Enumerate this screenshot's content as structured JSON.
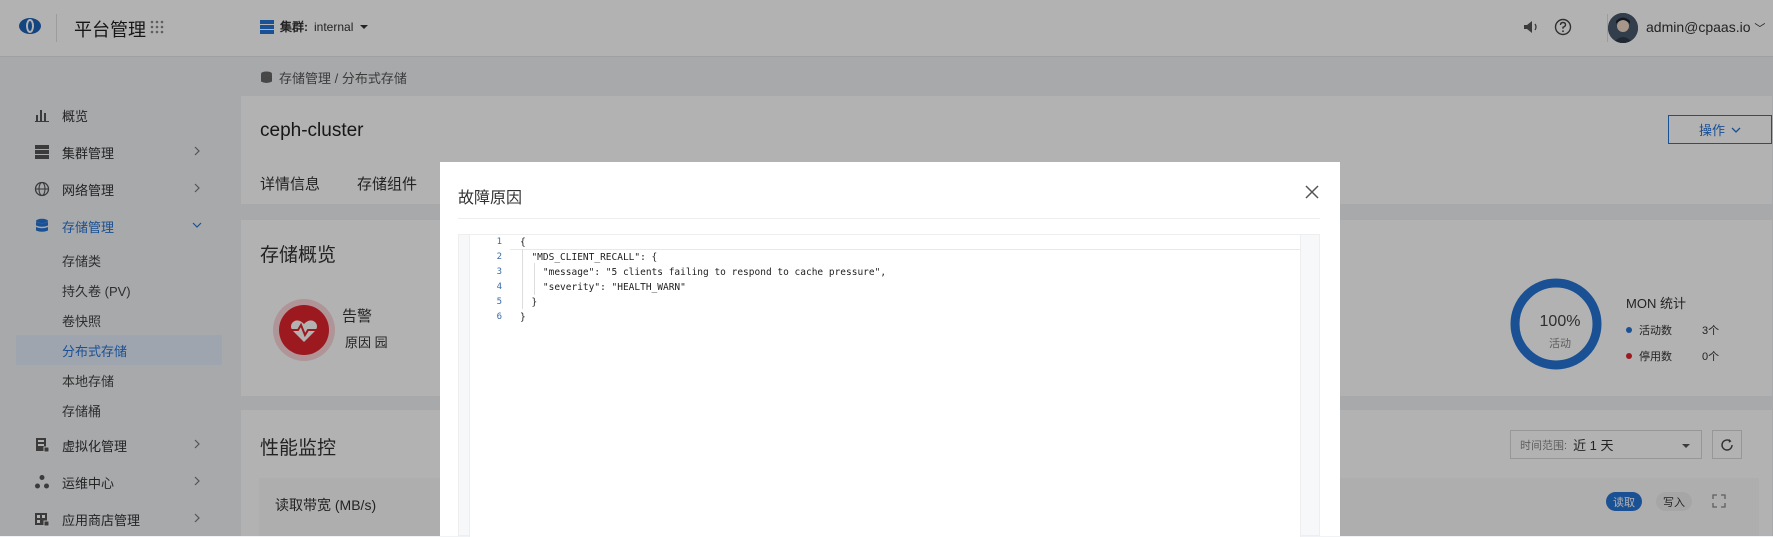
{
  "header": {
    "app_title": "平台管理",
    "cluster_label": "集群:",
    "cluster_value": "internal",
    "user": "admin@cpaas.io"
  },
  "breadcrumb": "存储管理 / 分布式存储",
  "sidebar": {
    "items": [
      {
        "label": "概览",
        "icon": "bar-chart-icon"
      },
      {
        "label": "集群管理",
        "icon": "server-icon"
      },
      {
        "label": "网络管理",
        "icon": "globe-icon"
      },
      {
        "label": "存储管理",
        "icon": "database-icon"
      },
      {
        "label": "虚拟化管理",
        "icon": "virtualization-icon"
      },
      {
        "label": "运维中心",
        "icon": "ops-icon"
      },
      {
        "label": "应用商店管理",
        "icon": "app-store-icon"
      }
    ],
    "storage_sub": [
      "存储类",
      "持久卷 (PV)",
      "卷快照",
      "分布式存储",
      "本地存储",
      "存储桶"
    ]
  },
  "page": {
    "title": "ceph-cluster",
    "action_label": "操作",
    "tabs": [
      "详情信息",
      "存储组件"
    ]
  },
  "overview": {
    "title": "存储概览",
    "alert_label": "告警",
    "alert_sub": "原因 园",
    "ring_percent": "100%",
    "ring_label": "活动",
    "ring_fraction": 1.0,
    "mon_title": "MON 统计",
    "mon_active_label": "活动数",
    "mon_active_count": "3个",
    "mon_inactive_label": "停用数",
    "mon_inactive_count": "0个"
  },
  "perf": {
    "title": "性能监控",
    "range_label": "时间范围:",
    "range_value": "近 1 天",
    "read_title": "读取带宽 (MB/s)",
    "toggle_read": "读取",
    "toggle_write": "写入"
  },
  "modal": {
    "title": "故障原因",
    "lines": [
      {
        "num": "1",
        "text": "{"
      },
      {
        "num": "2",
        "text": "  \"MDS_CLIENT_RECALL\": {"
      },
      {
        "num": "3",
        "text": "    \"message\": \"5 clients failing to respond to cache pressure\","
      },
      {
        "num": "4",
        "text": "    \"severity\": \"HEALTH_WARN\""
      },
      {
        "num": "5",
        "text": "  }"
      },
      {
        "num": "6",
        "text": "}"
      }
    ]
  },
  "colors": {
    "accent": "#2673d4",
    "danger": "#e0242d",
    "active_dot": "#2673d4",
    "inactive_dot": "#e0242d"
  }
}
